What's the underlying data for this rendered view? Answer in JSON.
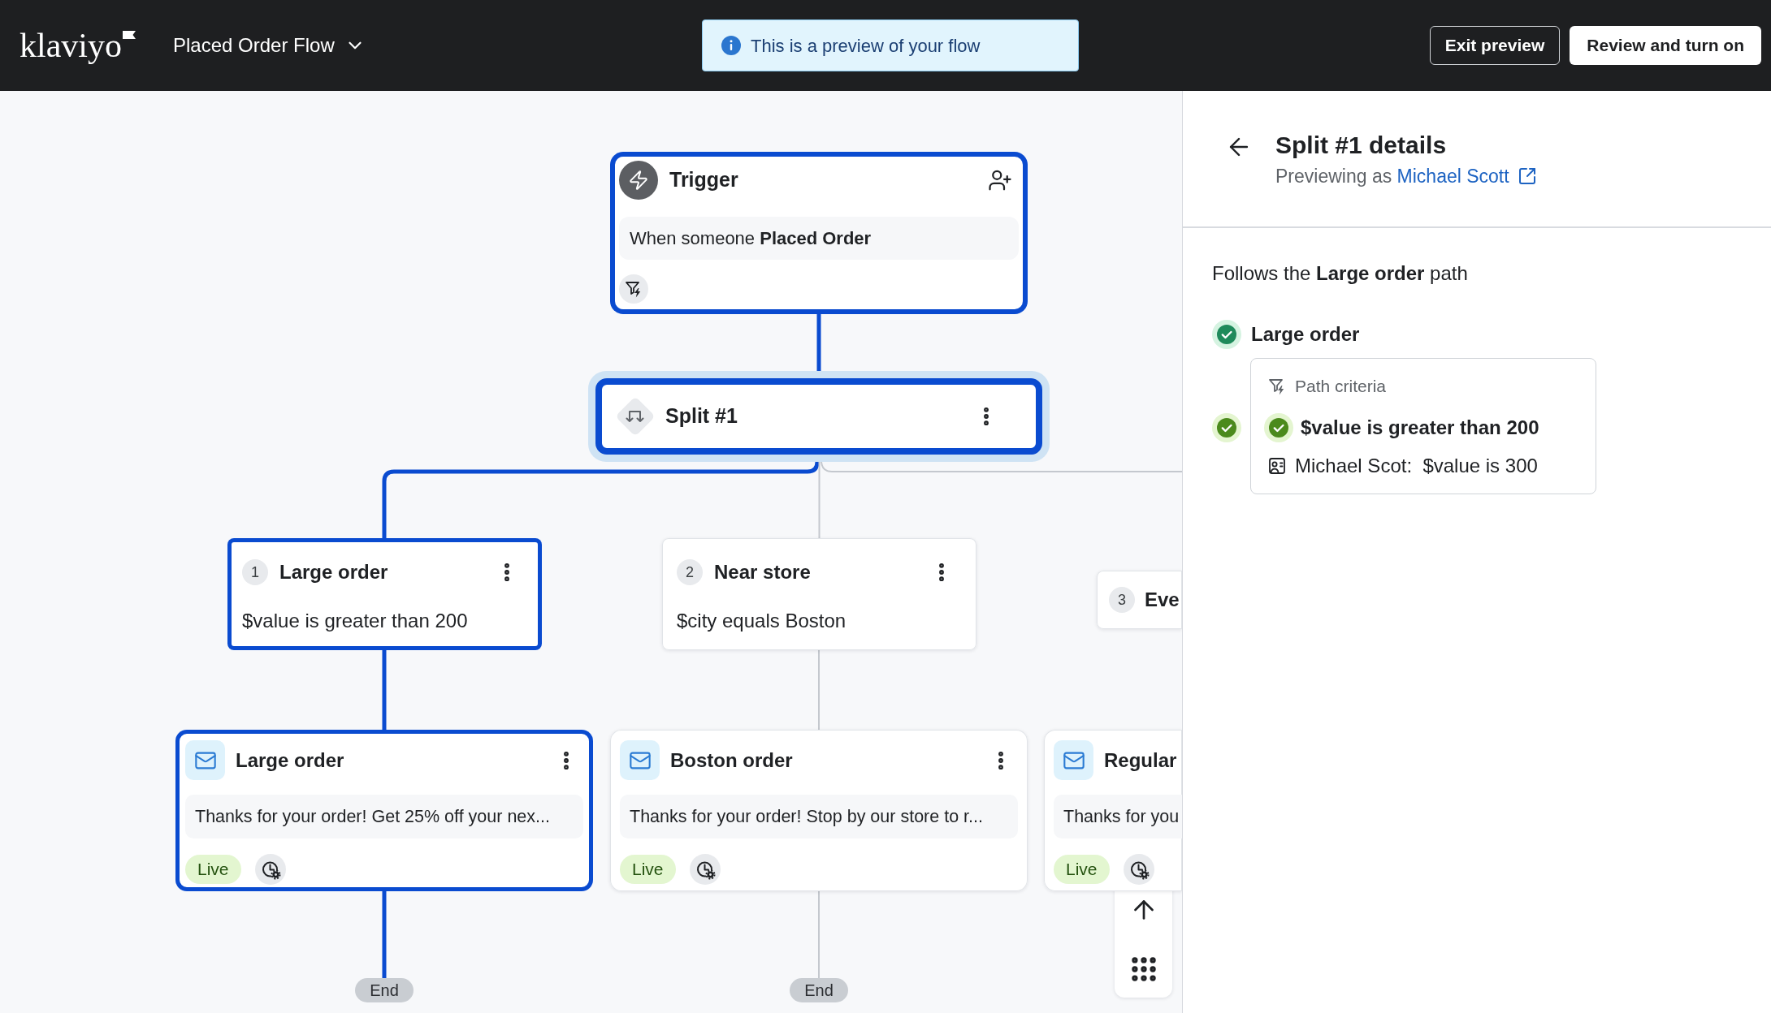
{
  "header": {
    "logo": "klaviyo",
    "flow_name": "Placed Order Flow",
    "notice": "This is a preview of your flow",
    "buttons": [
      {
        "label": "Exit preview",
        "kind": "outline"
      },
      {
        "label": "Review and turn on",
        "kind": "solid"
      }
    ]
  },
  "canvas": {
    "trigger": {
      "title": "Trigger",
      "description": "When someone **Placed Order**",
      "highlighted": true
    },
    "split": {
      "title": "Split #1",
      "selected": true
    },
    "branches": [
      {
        "number": "1",
        "title": "Large order",
        "condition": "$value is greater than 200",
        "highlighted": true
      },
      {
        "number": "2",
        "title": "Near store",
        "condition": "$city equals Boston",
        "highlighted": false
      },
      {
        "number": "3",
        "title": "Eve",
        "highlighted": false
      }
    ],
    "emails": [
      {
        "title": "Large order",
        "preview": "Thanks for your order! Get 25% off your nex...",
        "status": "Live",
        "highlighted": true
      },
      {
        "title": "Boston order",
        "preview": "Thanks for your order! Stop by our store to r...",
        "status": "Live",
        "highlighted": false
      },
      {
        "title": "Regular",
        "preview": "Thanks for you",
        "status": "Live",
        "highlighted": false
      }
    ],
    "ends": [
      "End",
      "End"
    ]
  },
  "details_panel": {
    "title": "Split #1 details",
    "previewing_prefix": "Previewing as",
    "contact": "Michael Scott",
    "summary": "Follows the **Large order** path",
    "path": {
      "label": "Large order",
      "matched": true
    },
    "criteria_heading": "Path criteria",
    "criteria": [
      {
        "text": "$value is greater than 200",
        "met": true,
        "evaluation": "Michael Scot:  $value is 300"
      }
    ]
  }
}
